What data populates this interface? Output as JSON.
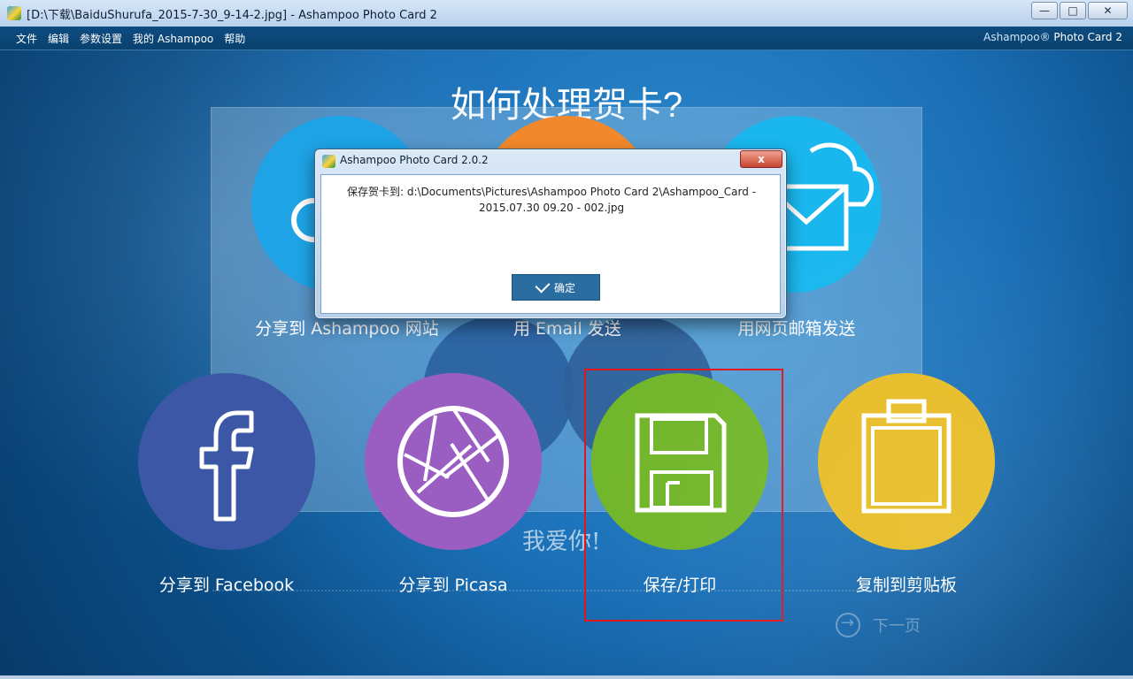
{
  "window": {
    "title": "[D:\\下载\\BaiduShurufa_2015-7-30_9-14-2.jpg] - Ashampoo Photo Card 2",
    "min_label": "—",
    "max_label": "□",
    "close_label": "✕"
  },
  "menu": {
    "items": [
      "文件",
      "编辑",
      "参数设置",
      "我的 Ashampoo",
      "帮助"
    ],
    "brand_prefix": "Ashampoo®",
    "brand_name": "Photo Card 2"
  },
  "main": {
    "heading": "如何处理贺卡?",
    "card_text": "我爱你!",
    "options_top": [
      {
        "label": "分享到 Ashampoo 网站",
        "color": "#1EA3E6"
      },
      {
        "label": "用 Email 发送",
        "color": "#F1892C"
      },
      {
        "label": "用网页邮箱发送",
        "color": "#19B7EE"
      }
    ],
    "options_bottom": [
      {
        "label": "分享到 Facebook",
        "color": "#3B57A6"
      },
      {
        "label": "分享到 Picasa",
        "color": "#9A5EC2"
      },
      {
        "label": "保存/打印",
        "color": "#72B62B"
      },
      {
        "label": "复制到剪贴板",
        "color": "#E7BC25"
      }
    ],
    "next_label": "下一页"
  },
  "dialog": {
    "title": "Ashampoo Photo Card 2.0.2",
    "close_label": "x",
    "message_line1": "保存贺卡到: d:\\Documents\\Pictures\\Ashampoo Photo Card 2\\Ashampoo_Card -",
    "message_line2": "2015.07.30 09.20 - 002.jpg",
    "ok_label": "确定"
  },
  "highlight_color": "#E2151B"
}
